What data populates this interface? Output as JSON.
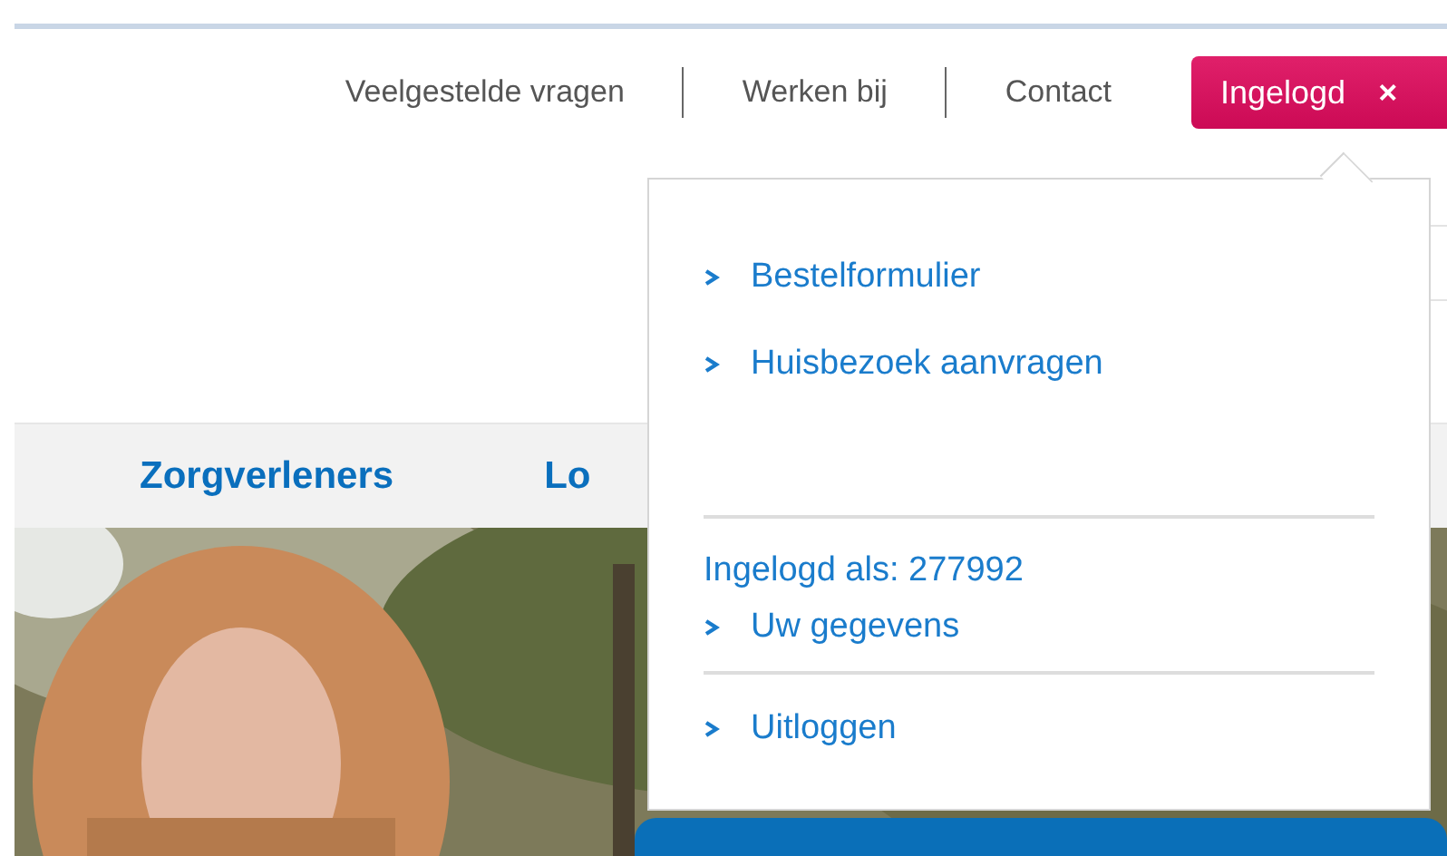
{
  "top_links": [
    {
      "label": "Veelgestelde vragen"
    },
    {
      "label": "Werken bij"
    },
    {
      "label": "Contact"
    }
  ],
  "account_button": {
    "label": "Ingelogd",
    "close": "×",
    "expanded": true
  },
  "main_nav": [
    {
      "label": "Zorgverleners"
    },
    {
      "label": "Lo"
    }
  ],
  "account_menu": {
    "links": [
      {
        "label": "Bestelformulier"
      },
      {
        "label": "Huisbezoek aanvragen"
      }
    ],
    "logged_in_as": "Ingelogd als: 277992",
    "account_links": [
      {
        "label": "Uw gegevens"
      }
    ],
    "logout_links": [
      {
        "label": "Uitloggen"
      }
    ]
  }
}
